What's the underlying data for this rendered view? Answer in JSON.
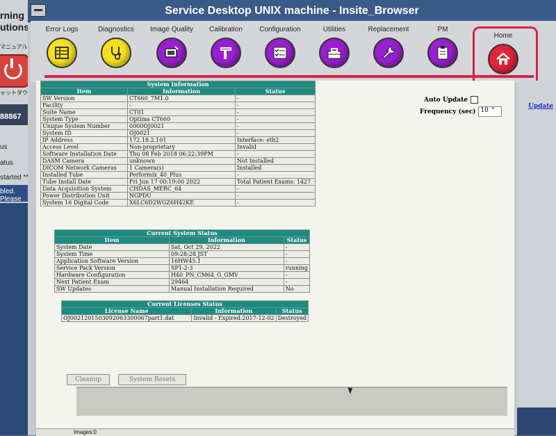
{
  "left_panel": {
    "brand_line1": "rning",
    "brand_line2": "utions",
    "manual_label": "マニュアル",
    "shutdown_label": "ャットダウン",
    "code": "88867",
    "status_line1": "us",
    "status_line2": "atus",
    "started_text": "started ****",
    "message_text": "bled.  Please"
  },
  "window": {
    "title": "Service Desktop UNIX machine - Insite_Browser"
  },
  "toolbar": {
    "tools": [
      {
        "label": "Error Logs",
        "color": "#f7e21a",
        "icon": "log-grid-icon"
      },
      {
        "label": "Diagnostics",
        "color": "#f7e21a",
        "icon": "stethoscope-icon"
      },
      {
        "label": "Image Quality",
        "color": "#9a1fd1",
        "icon": "monitor-icon"
      },
      {
        "label": "Calibration",
        "color": "#9a1fd1",
        "icon": "caliper-icon"
      },
      {
        "label": "Configuration",
        "color": "#9a1fd1",
        "icon": "checklist-icon"
      },
      {
        "label": "Utilities",
        "color": "#9a1fd1",
        "icon": "toolbox-icon"
      },
      {
        "label": "Replacement",
        "color": "#9a1fd1",
        "icon": "wrench-icon"
      },
      {
        "label": "PM",
        "color": "#9a1fd1",
        "icon": "clipboard-icon"
      }
    ],
    "home_label": "Home",
    "home_color": "#e1243a"
  },
  "system_info": {
    "caption": "System Information",
    "headers": [
      "Item",
      "Information",
      "Status"
    ],
    "rows": [
      [
        "SW Version",
        "CT660_7M1.0",
        "-"
      ],
      [
        "Facility",
        "-",
        "-"
      ],
      [
        "Suite Name",
        "CT01",
        "-"
      ],
      [
        "System Type",
        "Optima CT660",
        "-"
      ],
      [
        "Unique System Number",
        "0000OJ0021",
        "-"
      ],
      [
        "System ID",
        "OJ0021",
        "-"
      ],
      [
        "IP Address",
        "172.18.2.101",
        "Interface: eth2"
      ],
      [
        "Access Level",
        "Non-proprietary",
        "Invalid"
      ],
      [
        "Software Installation Date",
        "Thu 08 Feb 2018 06:22:39PM",
        "-"
      ],
      [
        "DASM Camera",
        "unknown",
        "Not Installed"
      ],
      [
        "DICOM Network Cameras",
        "1 Camera(s)",
        "Installed"
      ],
      [
        "Installed Tube",
        "Performix_40_Plus",
        "-"
      ],
      [
        "Tube Install Date",
        "Fri Jun 17 00:19:00 2022",
        "Total Patient Exams: 1427"
      ],
      [
        "Data Acquisition System",
        "CHDAS_MERC_64",
        "-"
      ],
      [
        "Power Distribution Unit",
        "NGPDU",
        "-"
      ],
      [
        "System 16 Digital Code",
        "X6LC6D2WGZ6H42KE",
        "-"
      ]
    ]
  },
  "current_status": {
    "caption": "Current System Status",
    "headers": [
      "Item",
      "Information",
      "Status"
    ],
    "rows": [
      [
        "System Date",
        "Sat, Oct 29, 2022",
        "-"
      ],
      [
        "System Time",
        "09:28:28 JST",
        "-"
      ],
      [
        "Application Software Version",
        "16HW45.1",
        "-"
      ],
      [
        "Service Pack Version",
        "SP1-2-3",
        "running"
      ],
      [
        "Hardware Configuration",
        "H40_PN_CM64_G_GMV",
        "-"
      ],
      [
        "Next Patient Exam",
        "29464",
        "-"
      ],
      [
        "SW Updates",
        "Manual Installation Required",
        "No"
      ]
    ]
  },
  "licenses": {
    "caption": "Current Licenses Status",
    "headers": [
      "License Name",
      "Information",
      "Status"
    ],
    "rows": [
      [
        "OJ0021201503092063300067part1.dat",
        "Invalid - Expired:2017-12-02",
        "Destroyed"
      ]
    ]
  },
  "controls": {
    "auto_update_label": "Auto Update",
    "frequency_label": "Frequency (sec)",
    "frequency_value": "10",
    "update_link": "Update",
    "cleanup_label": "Cleanup",
    "system_resets_label": "System Resets"
  },
  "status_bar": {
    "text": "Images:0"
  }
}
